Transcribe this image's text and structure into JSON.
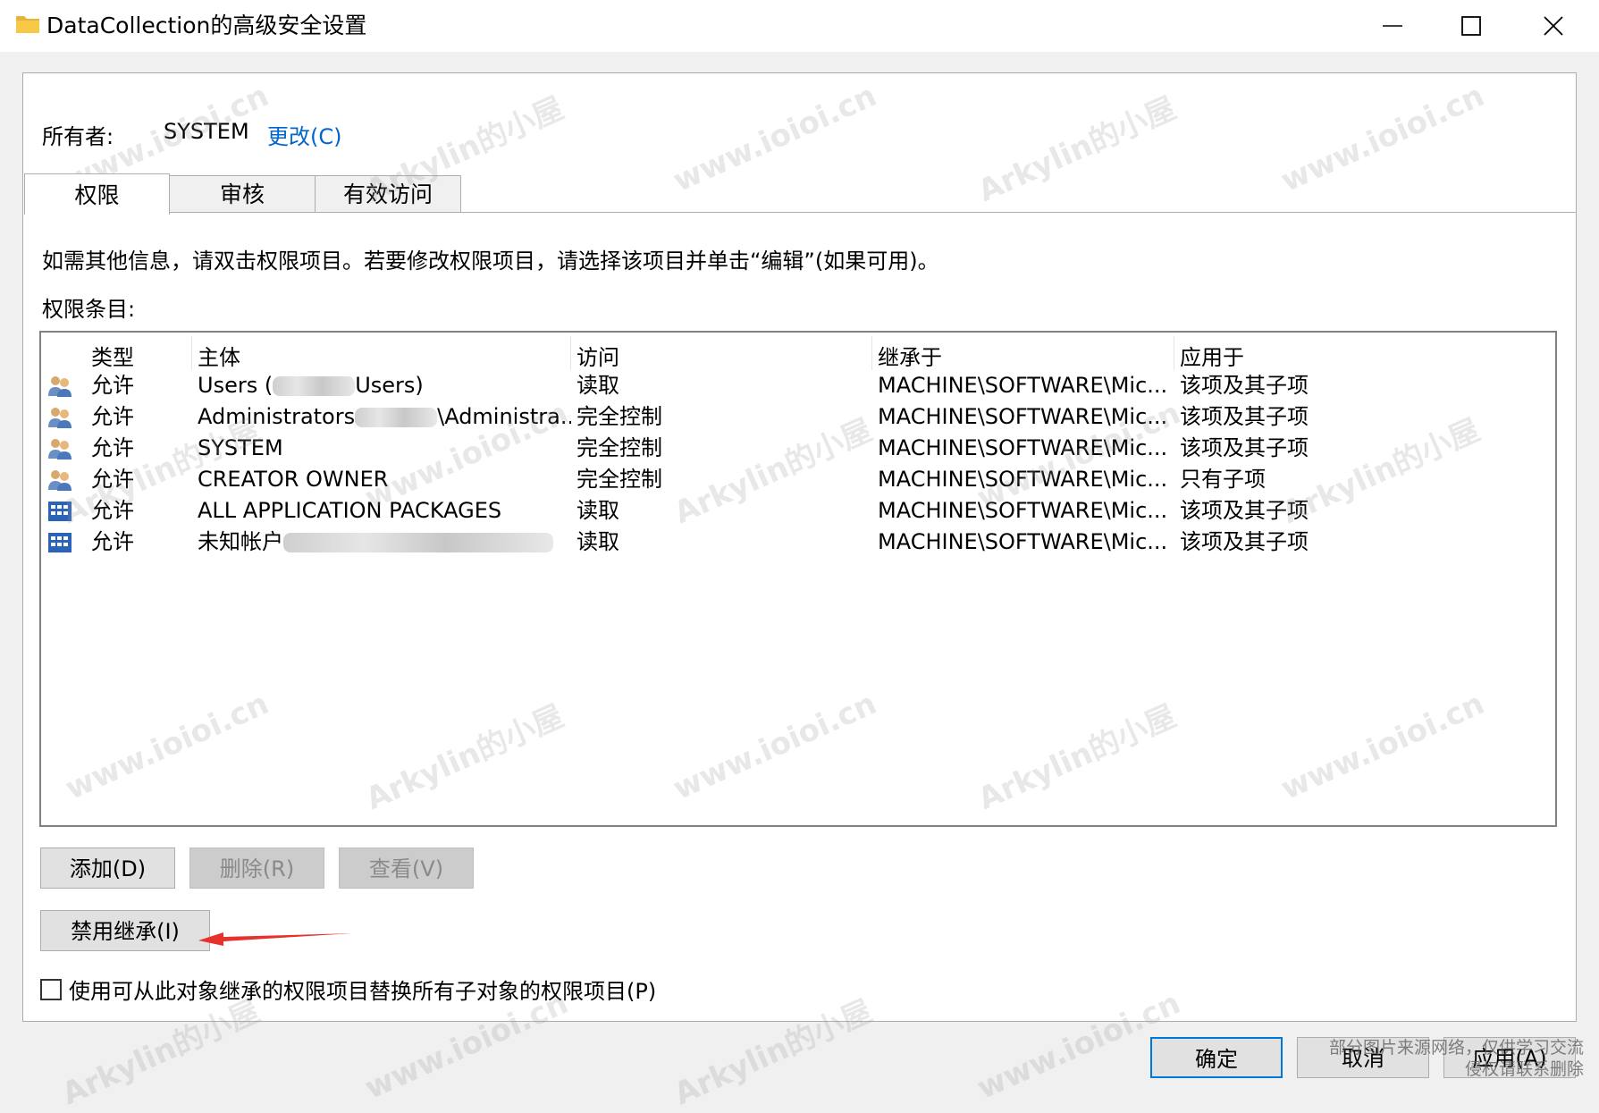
{
  "window": {
    "title": "DataCollection的高级安全设置",
    "controls": {
      "minimize": "minimize",
      "maximize": "maximize",
      "close": "close"
    }
  },
  "owner": {
    "label": "所有者:",
    "value": "SYSTEM",
    "change_link": "更改(C)"
  },
  "tabs": [
    {
      "label": "权限",
      "active": true
    },
    {
      "label": "审核",
      "active": false
    },
    {
      "label": "有效访问",
      "active": false
    }
  ],
  "info_text": "如需其他信息，请双击权限项目。若要修改权限项目，请选择该项目并单击“编辑”(如果可用)。",
  "entries_label": "权限条目:",
  "table": {
    "columns": [
      "类型",
      "主体",
      "访问",
      "继承于",
      "应用于"
    ],
    "rows": [
      {
        "icon": "user-group-icon",
        "type": "允许",
        "principal_pre": "Users (",
        "principal_post": "Users)",
        "access": "读取",
        "inherited": "MACHINE\\SOFTWARE\\Mic...",
        "applies": "该项及其子项"
      },
      {
        "icon": "user-group-icon",
        "type": "允许",
        "principal_pre": "Administrators",
        "principal_post": "\\Administra...",
        "access": "完全控制",
        "inherited": "MACHINE\\SOFTWARE\\Mic...",
        "applies": "该项及其子项"
      },
      {
        "icon": "user-group-icon",
        "type": "允许",
        "principal_pre": "SYSTEM",
        "principal_post": "",
        "access": "完全控制",
        "inherited": "MACHINE\\SOFTWARE\\Mic...",
        "applies": "该项及其子项"
      },
      {
        "icon": "user-group-icon",
        "type": "允许",
        "principal_pre": "CREATOR OWNER",
        "principal_post": "",
        "access": "完全控制",
        "inherited": "MACHINE\\SOFTWARE\\Mic...",
        "applies": "只有子项"
      },
      {
        "icon": "app-package-icon",
        "type": "允许",
        "principal_pre": "ALL APPLICATION PACKAGES",
        "principal_post": "",
        "access": "读取",
        "inherited": "MACHINE\\SOFTWARE\\Mic...",
        "applies": "该项及其子项"
      },
      {
        "icon": "app-package-icon",
        "type": "允许",
        "principal_pre": "未知帐户",
        "principal_post": "",
        "access": "读取",
        "inherited": "MACHINE\\SOFTWARE\\Mic...",
        "applies": "该项及其子项"
      }
    ]
  },
  "buttons": {
    "add": "添加(D)",
    "remove": "删除(R)",
    "view": "查看(V)",
    "disable_inheritance": "禁用继承(I)",
    "ok": "确定",
    "cancel": "取消",
    "apply": "应用(A)"
  },
  "checkbox": {
    "label": "使用可从此对象继承的权限项目替换所有子对象的权限项目(P)",
    "checked": false
  },
  "watermarks": [
    "www.ioioi.cn",
    "Arkylin的小屋"
  ],
  "corner_note": [
    "部分图片来源网络，仅供学习交流",
    "侵权请联系删除"
  ],
  "colors": {
    "link": "#0066cc",
    "primary_border": "#0078d7",
    "arrow": "#e8302c"
  }
}
